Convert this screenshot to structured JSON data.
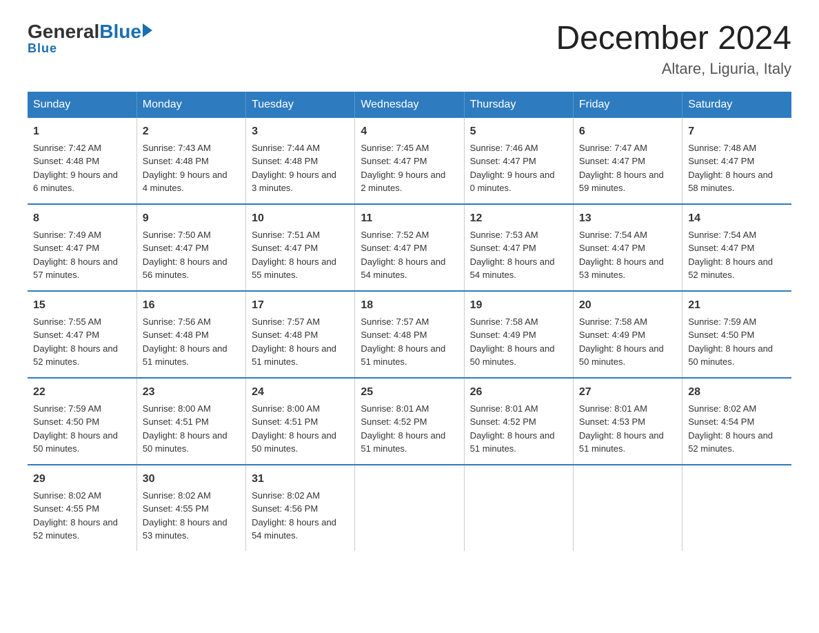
{
  "logo": {
    "general": "General",
    "blue": "Blue",
    "underline": "Blue"
  },
  "header": {
    "month_year": "December 2024",
    "location": "Altare, Liguria, Italy"
  },
  "days_of_week": [
    "Sunday",
    "Monday",
    "Tuesday",
    "Wednesday",
    "Thursday",
    "Friday",
    "Saturday"
  ],
  "weeks": [
    [
      {
        "day": "1",
        "sunrise": "7:42 AM",
        "sunset": "4:48 PM",
        "daylight": "9 hours and 6 minutes."
      },
      {
        "day": "2",
        "sunrise": "7:43 AM",
        "sunset": "4:48 PM",
        "daylight": "9 hours and 4 minutes."
      },
      {
        "day": "3",
        "sunrise": "7:44 AM",
        "sunset": "4:48 PM",
        "daylight": "9 hours and 3 minutes."
      },
      {
        "day": "4",
        "sunrise": "7:45 AM",
        "sunset": "4:47 PM",
        "daylight": "9 hours and 2 minutes."
      },
      {
        "day": "5",
        "sunrise": "7:46 AM",
        "sunset": "4:47 PM",
        "daylight": "9 hours and 0 minutes."
      },
      {
        "day": "6",
        "sunrise": "7:47 AM",
        "sunset": "4:47 PM",
        "daylight": "8 hours and 59 minutes."
      },
      {
        "day": "7",
        "sunrise": "7:48 AM",
        "sunset": "4:47 PM",
        "daylight": "8 hours and 58 minutes."
      }
    ],
    [
      {
        "day": "8",
        "sunrise": "7:49 AM",
        "sunset": "4:47 PM",
        "daylight": "8 hours and 57 minutes."
      },
      {
        "day": "9",
        "sunrise": "7:50 AM",
        "sunset": "4:47 PM",
        "daylight": "8 hours and 56 minutes."
      },
      {
        "day": "10",
        "sunrise": "7:51 AM",
        "sunset": "4:47 PM",
        "daylight": "8 hours and 55 minutes."
      },
      {
        "day": "11",
        "sunrise": "7:52 AM",
        "sunset": "4:47 PM",
        "daylight": "8 hours and 54 minutes."
      },
      {
        "day": "12",
        "sunrise": "7:53 AM",
        "sunset": "4:47 PM",
        "daylight": "8 hours and 54 minutes."
      },
      {
        "day": "13",
        "sunrise": "7:54 AM",
        "sunset": "4:47 PM",
        "daylight": "8 hours and 53 minutes."
      },
      {
        "day": "14",
        "sunrise": "7:54 AM",
        "sunset": "4:47 PM",
        "daylight": "8 hours and 52 minutes."
      }
    ],
    [
      {
        "day": "15",
        "sunrise": "7:55 AM",
        "sunset": "4:47 PM",
        "daylight": "8 hours and 52 minutes."
      },
      {
        "day": "16",
        "sunrise": "7:56 AM",
        "sunset": "4:48 PM",
        "daylight": "8 hours and 51 minutes."
      },
      {
        "day": "17",
        "sunrise": "7:57 AM",
        "sunset": "4:48 PM",
        "daylight": "8 hours and 51 minutes."
      },
      {
        "day": "18",
        "sunrise": "7:57 AM",
        "sunset": "4:48 PM",
        "daylight": "8 hours and 51 minutes."
      },
      {
        "day": "19",
        "sunrise": "7:58 AM",
        "sunset": "4:49 PM",
        "daylight": "8 hours and 50 minutes."
      },
      {
        "day": "20",
        "sunrise": "7:58 AM",
        "sunset": "4:49 PM",
        "daylight": "8 hours and 50 minutes."
      },
      {
        "day": "21",
        "sunrise": "7:59 AM",
        "sunset": "4:50 PM",
        "daylight": "8 hours and 50 minutes."
      }
    ],
    [
      {
        "day": "22",
        "sunrise": "7:59 AM",
        "sunset": "4:50 PM",
        "daylight": "8 hours and 50 minutes."
      },
      {
        "day": "23",
        "sunrise": "8:00 AM",
        "sunset": "4:51 PM",
        "daylight": "8 hours and 50 minutes."
      },
      {
        "day": "24",
        "sunrise": "8:00 AM",
        "sunset": "4:51 PM",
        "daylight": "8 hours and 50 minutes."
      },
      {
        "day": "25",
        "sunrise": "8:01 AM",
        "sunset": "4:52 PM",
        "daylight": "8 hours and 51 minutes."
      },
      {
        "day": "26",
        "sunrise": "8:01 AM",
        "sunset": "4:52 PM",
        "daylight": "8 hours and 51 minutes."
      },
      {
        "day": "27",
        "sunrise": "8:01 AM",
        "sunset": "4:53 PM",
        "daylight": "8 hours and 51 minutes."
      },
      {
        "day": "28",
        "sunrise": "8:02 AM",
        "sunset": "4:54 PM",
        "daylight": "8 hours and 52 minutes."
      }
    ],
    [
      {
        "day": "29",
        "sunrise": "8:02 AM",
        "sunset": "4:55 PM",
        "daylight": "8 hours and 52 minutes."
      },
      {
        "day": "30",
        "sunrise": "8:02 AM",
        "sunset": "4:55 PM",
        "daylight": "8 hours and 53 minutes."
      },
      {
        "day": "31",
        "sunrise": "8:02 AM",
        "sunset": "4:56 PM",
        "daylight": "8 hours and 54 minutes."
      },
      {
        "day": "",
        "sunrise": "",
        "sunset": "",
        "daylight": ""
      },
      {
        "day": "",
        "sunrise": "",
        "sunset": "",
        "daylight": ""
      },
      {
        "day": "",
        "sunrise": "",
        "sunset": "",
        "daylight": ""
      },
      {
        "day": "",
        "sunrise": "",
        "sunset": "",
        "daylight": ""
      }
    ]
  ],
  "labels": {
    "sunrise": "Sunrise: ",
    "sunset": "Sunset: ",
    "daylight": "Daylight: "
  }
}
